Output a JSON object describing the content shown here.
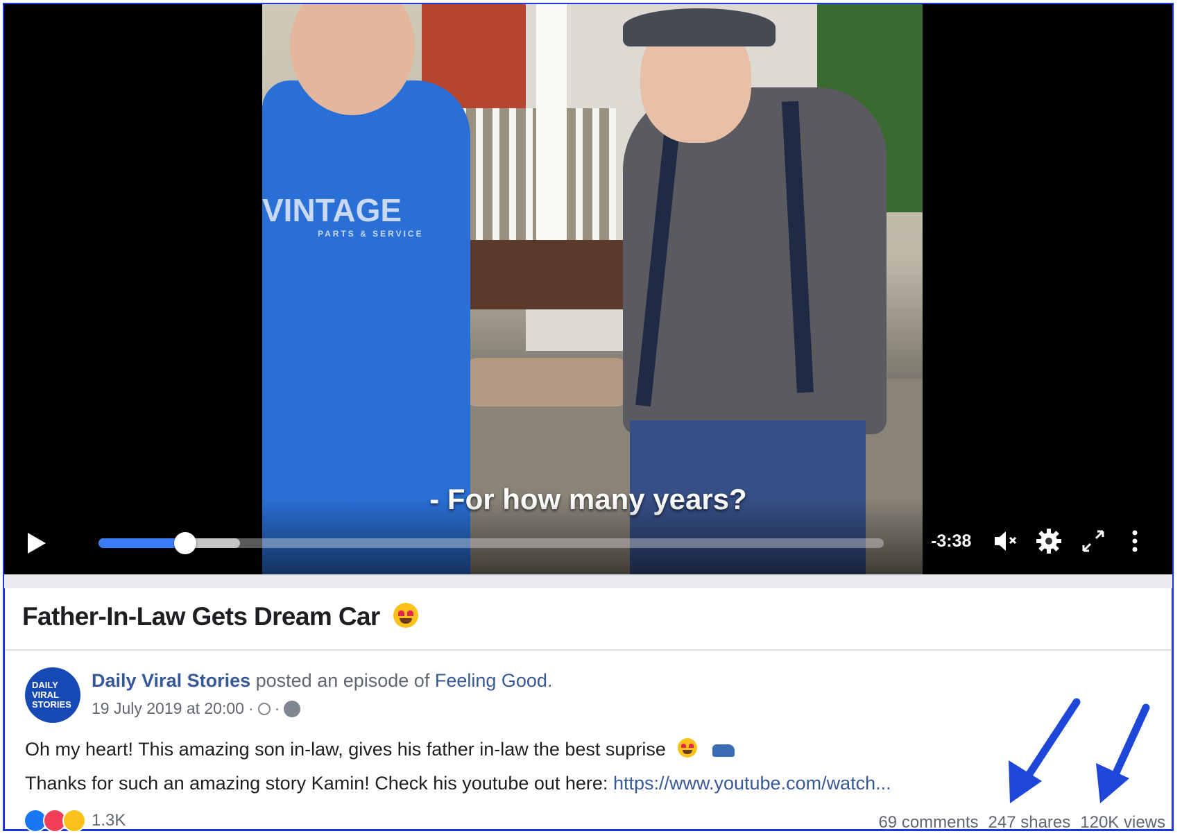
{
  "video": {
    "subtitle": "- For how many years?",
    "time_remaining": "-3:38",
    "progress_fraction": 0.11,
    "buffered_fraction": 0.18,
    "shirt_text": "VINTAGE",
    "shirt_subtext": "PARTS & SERVICE"
  },
  "post": {
    "title": "Father-In-Law Gets Dream Car",
    "avatar_lines": [
      "DAILY",
      "VIRAL",
      "STORIES"
    ],
    "author": "Daily Viral Stories",
    "posted_text": " posted an episode of ",
    "show": "Feeling Good",
    "show_suffix": ".",
    "date": "19 July 2019 at 20:00",
    "meta_separator": "·",
    "text_line1": "Oh my heart! This amazing son in-law, gives his father in-law the best suprise",
    "text_line2_prefix": "Thanks for such an amazing story Kamin! Check his youtube out here: ",
    "link": "https://www.youtube.com/watch..."
  },
  "engagement": {
    "reaction_count": "1.3K",
    "comments": "69 comments",
    "shares": "247 shares",
    "views": "120K views"
  },
  "colors": {
    "frame_border": "#1f37e0",
    "progress_blue": "#3a7cf5",
    "link_blue": "#385898",
    "arrow_blue": "#1e46d8"
  }
}
